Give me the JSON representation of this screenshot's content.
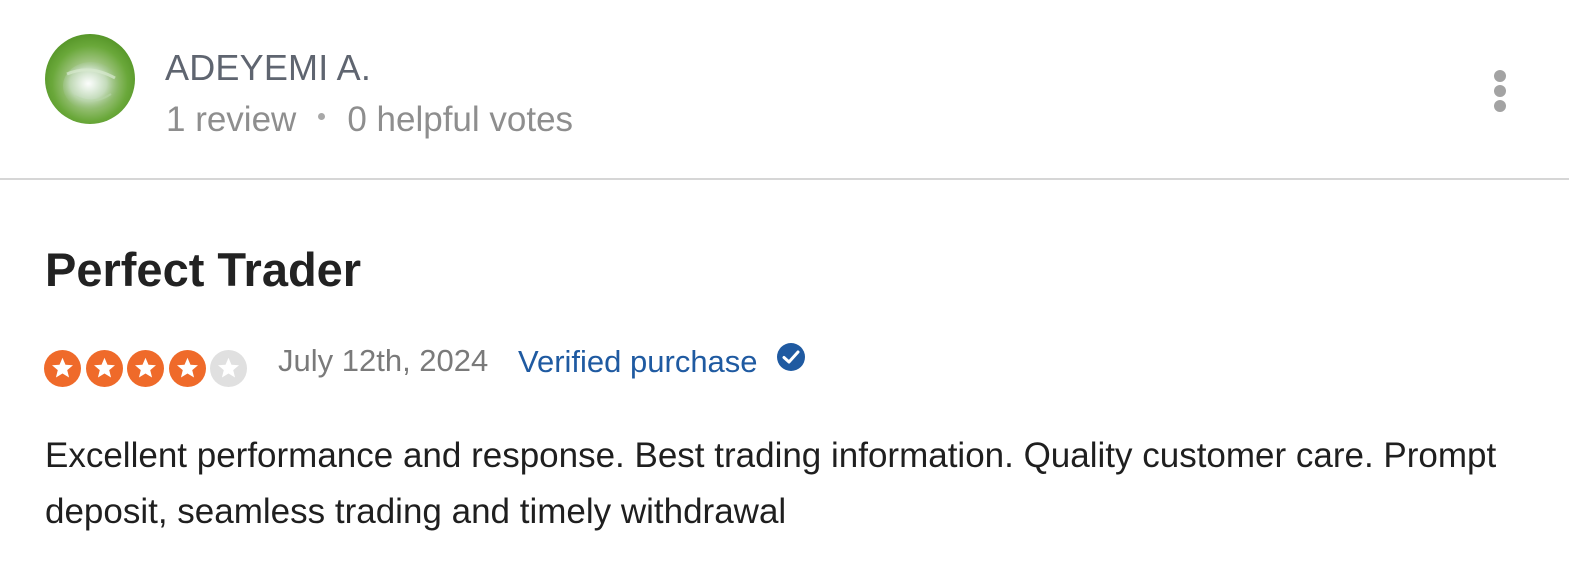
{
  "reviewer": {
    "name": "ADEYEMI A.",
    "review_count": "1 review",
    "helpful_votes": "0 helpful votes"
  },
  "review": {
    "title": "Perfect Trader",
    "rating": 4,
    "max_rating": 5,
    "date": "July 12th, 2024",
    "verified_label": "Verified purchase",
    "text": "Excellent performance and response. Best trading information. Quality customer care. Prompt deposit, seamless trading and timely withdrawal"
  },
  "colors": {
    "star_filled": "#ef6a2a",
    "star_empty": "#e0e0e0",
    "verified": "#1f5aa1",
    "divider": "#d6d6d6"
  },
  "icons": {
    "menu": "more-vertical-icon",
    "verified": "check-circle-icon",
    "star": "star-icon"
  }
}
